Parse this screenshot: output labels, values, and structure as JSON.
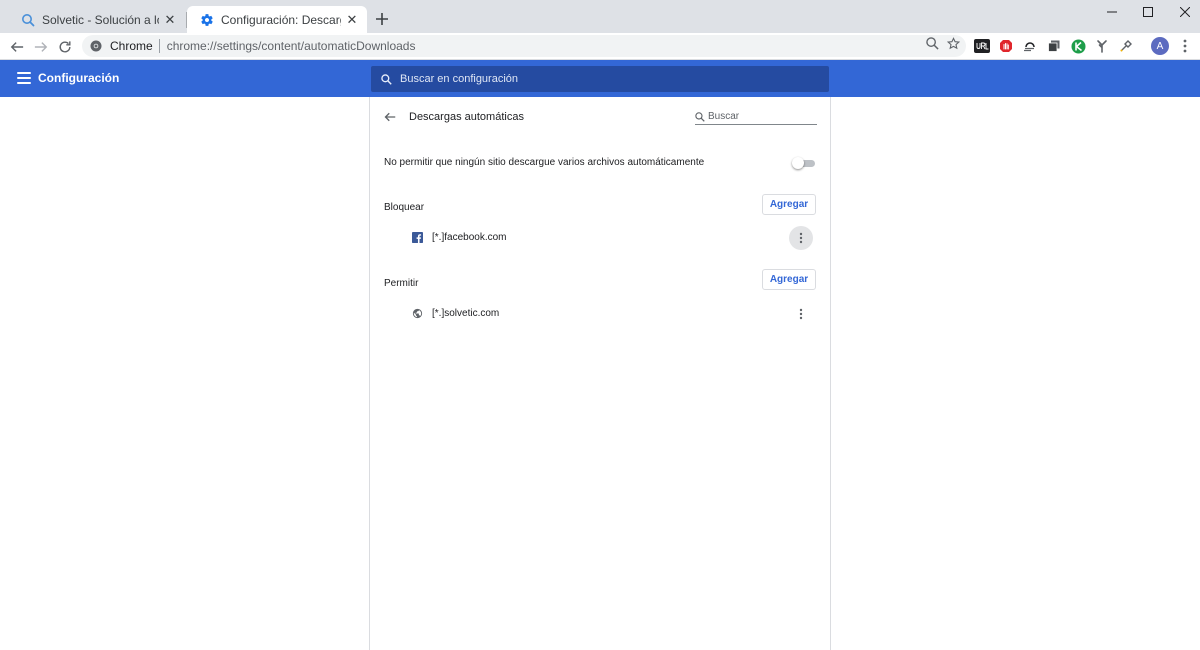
{
  "tabs": [
    {
      "title": "Solvetic - Solución a los problemas",
      "icon": "solvetic-search-icon",
      "active": false
    },
    {
      "title": "Configuración: Descargas automáticas",
      "icon": "settings-gear-icon",
      "active": true
    }
  ],
  "omnibox": {
    "chip": "Chrome",
    "url": "chrome://settings/content/automaticDownloads"
  },
  "profile": {
    "initial": "A"
  },
  "header": {
    "title": "Configuración",
    "search_placeholder": "Buscar en configuración"
  },
  "subpage": {
    "title": "Descargas automáticas",
    "search_placeholder": "Buscar",
    "toggle_label": "No permitir que ningún sitio descargue varios archivos automáticamente",
    "toggle_on": false
  },
  "sections": {
    "block": {
      "label": "Bloquear",
      "add_label": "Agregar",
      "sites": [
        {
          "name": "[*.]facebook.com",
          "icon": "facebook-icon"
        }
      ]
    },
    "allow": {
      "label": "Permitir",
      "add_label": "Agregar",
      "sites": [
        {
          "name": "[*.]solvetic.com",
          "icon": "globe-icon"
        }
      ]
    }
  },
  "colors": {
    "header_blue": "#3367d6",
    "search_blue": "#254ba1",
    "facebook_blue": "#3b5998",
    "accent_text": "#3367d6"
  }
}
